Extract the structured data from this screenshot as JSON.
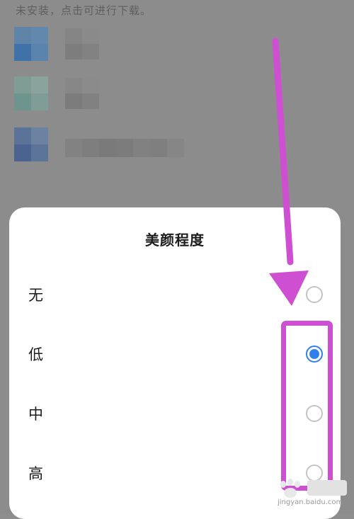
{
  "background": {
    "hint_text": "未安装，点击可进行下载。"
  },
  "dialog": {
    "title": "美颜程度",
    "options": [
      {
        "label": "无",
        "selected": false
      },
      {
        "label": "低",
        "selected": true
      },
      {
        "label": "中",
        "selected": false
      },
      {
        "label": "高",
        "selected": false
      }
    ]
  },
  "watermark": {
    "text": "jingyan.baidu.com"
  },
  "colors": {
    "accent": "#2f7ff0",
    "annotation": "#cf4fd3",
    "overlay": "#8c8c8c"
  }
}
